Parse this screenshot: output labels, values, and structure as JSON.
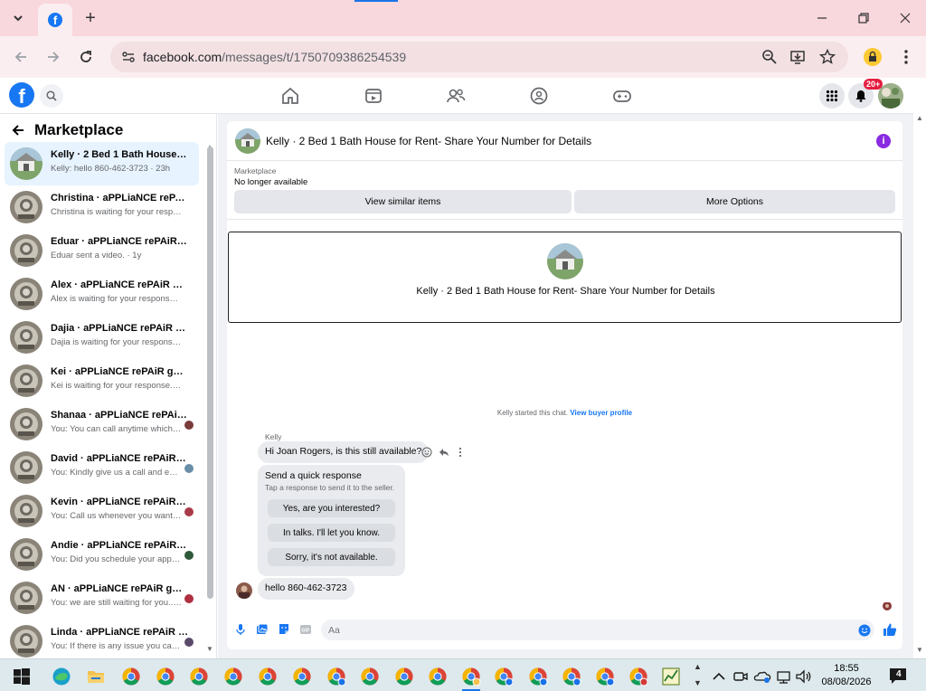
{
  "browser": {
    "url_host": "facebook.com",
    "url_path": "/messages/t/1750709386254539"
  },
  "header": {
    "notifications_badge": "20+"
  },
  "sidebar": {
    "title": "Marketplace",
    "conversations": [
      {
        "name": "Kelly · 2 Bed 1 Bath House for R...",
        "preview": "Kelly: hello 860-462-3723 · 23h",
        "active": true,
        "seen_color": ""
      },
      {
        "name": "Christina · aPPLiaNCE rePAiR g...",
        "preview": "Christina is waiting for your respo... · 1y",
        "active": false,
        "seen_color": ""
      },
      {
        "name": "Eduar · aPPLiaNCE rePAiR gUY ...",
        "preview": "Eduar sent a video. · 1y",
        "active": false,
        "seen_color": ""
      },
      {
        "name": "Alex · aPPLiaNCE rePAiR gUY +...",
        "preview": "Alex is waiting for your response. · 1y",
        "active": false,
        "seen_color": ""
      },
      {
        "name": "Dajia · aPPLiaNCE rePAiR gUY ...",
        "preview": "Dajia is waiting for your response. · 1y",
        "active": false,
        "seen_color": ""
      },
      {
        "name": "Kei · aPPLiaNCE rePAiR gUY + ...",
        "preview": "Kei is waiting for your response. · 1y",
        "active": false,
        "seen_color": ""
      },
      {
        "name": "Shanaa · aPPLiaNCE rePAiR g...",
        "preview": "You: You can call anytime which... · 1y",
        "active": false,
        "seen_color": "#7a3b3b"
      },
      {
        "name": "David · aPPLiaNCE rePAiR gU...",
        "preview": "You: Kindly give us a call and en... · 1y",
        "active": false,
        "seen_color": "#6a8ea8"
      },
      {
        "name": "Kevin · aPPLiaNCE rePAiR gU...",
        "preview": "You: Call us whenever you want · 1y",
        "active": false,
        "seen_color": "#a83a4a"
      },
      {
        "name": "Andie · aPPLiaNCE rePAiR gU...",
        "preview": "You: Did you schedule your app... · 1y",
        "active": false,
        "seen_color": "#2f5a3a"
      },
      {
        "name": "AN · aPPLiaNCE rePAiR gUY ...",
        "preview": "You: we are still waiting for you... · 1y",
        "active": false,
        "seen_color": "#b03040"
      },
      {
        "name": "Linda · aPPLiaNCE rePAiR gU...",
        "preview": "You: If there is any issue you ca... · 1y",
        "active": false,
        "seen_color": "#5a4a6a"
      }
    ]
  },
  "chat": {
    "title": "Kelly · 2 Bed 1 Bath House for Rent- Share Your Number for Details",
    "marketplace_label": "Marketplace",
    "status": "No longer available",
    "view_similar": "View similar items",
    "more_options": "More Options",
    "listing_title": "Kelly · 2 Bed 1 Bath House for Rent- Share Your Number for Details",
    "started_text": "Kelly started this chat.",
    "buyer_profile_link": "View buyer profile",
    "sender_name": "Kelly",
    "incoming_message": "Hi Joan Rogers, is this still available?",
    "quick_title": "Send a quick response",
    "quick_subtitle": "Tap a response to send it to the seller.",
    "quick_replies": [
      "Yes, are you interested?",
      "In talks. I'll let you know.",
      "Sorry, it's not available."
    ],
    "outgoing_message": "hello 860-462-3723",
    "composer_placeholder": "Aa"
  },
  "taskbar": {
    "time": "18:55",
    "date": "08/08/2026",
    "notification_count": "4"
  },
  "colors": {
    "brand": "#1877f2",
    "tabbar": "#f8d7dd",
    "info": "#8a2be2"
  }
}
